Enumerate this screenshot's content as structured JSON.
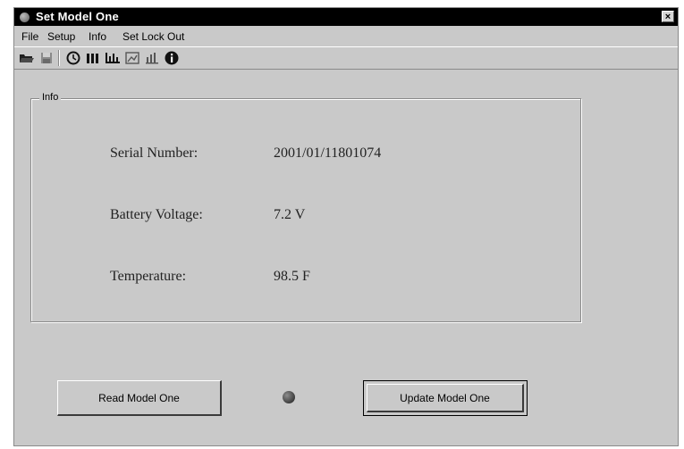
{
  "window": {
    "title": "Set Model One",
    "close_glyph": "×"
  },
  "menu": [
    "File",
    "Setup",
    "Info",
    "Set Lock Out"
  ],
  "toolbar": {
    "icons": [
      "open-folder-icon",
      "save-disk-icon",
      "clock-icon",
      "bar-columns-icon",
      "bar-chart-icon",
      "image-chart-icon",
      "small-bars-icon",
      "info-icon"
    ]
  },
  "info_group": {
    "legend": "Info",
    "fields": [
      {
        "label": "Serial Number:",
        "value": "2001/01/11801074"
      },
      {
        "label": "Battery Voltage:",
        "value": "7.2 V"
      },
      {
        "label": "Temperature:",
        "value": "98.5 F"
      }
    ]
  },
  "buttons": {
    "read": "Read Model One",
    "update": "Update Model One"
  }
}
